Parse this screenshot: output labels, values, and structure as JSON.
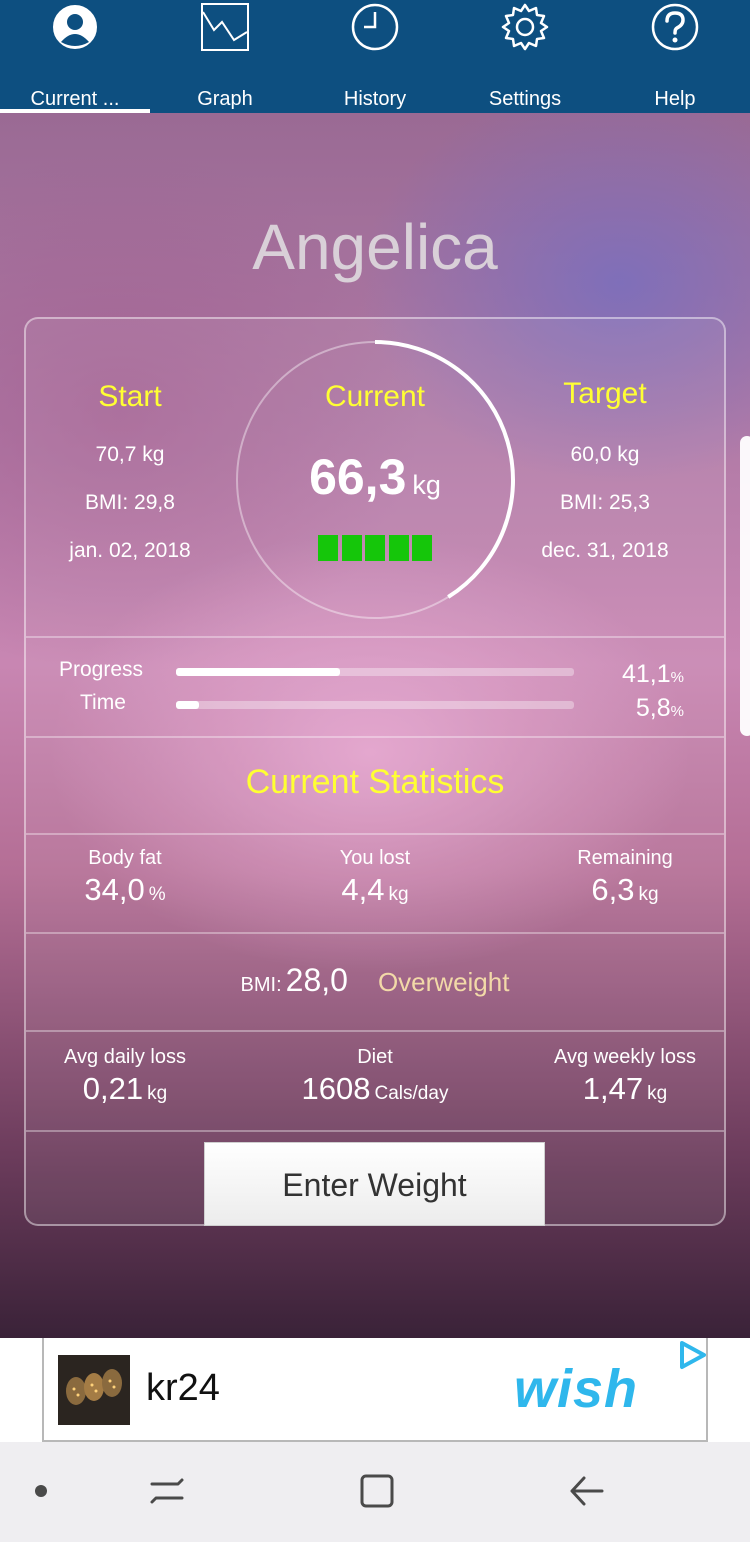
{
  "tabs": [
    {
      "label": "Current ...",
      "icon": "profile-icon",
      "active": true
    },
    {
      "label": "Graph",
      "icon": "graph-icon",
      "active": false
    },
    {
      "label": "History",
      "icon": "clock-icon",
      "active": false
    },
    {
      "label": "Settings",
      "icon": "gear-icon",
      "active": false
    },
    {
      "label": "Help",
      "icon": "help-icon",
      "active": false
    }
  ],
  "user": {
    "name": "Angelica"
  },
  "start": {
    "title": "Start",
    "weight": "70,7 kg",
    "bmi": "BMI: 29,8",
    "date": "jan. 02, 2018"
  },
  "current": {
    "title": "Current",
    "value": "66,3",
    "unit": "kg",
    "progress_blocks": 5
  },
  "target": {
    "title": "Target",
    "weight": "60,0 kg",
    "bmi": "BMI: 25,3",
    "date": "dec. 31, 2018"
  },
  "progress": {
    "progress_label": "Progress",
    "progress_value": "41,1",
    "progress_fraction": 0.411,
    "time_label": "Time",
    "time_value": "5,8",
    "time_fraction": 0.058,
    "pct_symbol": "%"
  },
  "stats": {
    "title": "Current Statistics",
    "body_fat": {
      "label": "Body fat",
      "value": "34,0",
      "unit": "%"
    },
    "you_lost": {
      "label": "You lost",
      "value": "4,4",
      "unit": "kg"
    },
    "remaining": {
      "label": "Remaining",
      "value": "6,3",
      "unit": "kg"
    },
    "bmi": {
      "label": "BMI:",
      "value": "28,0",
      "class": "Overweight"
    },
    "avg_daily": {
      "label": "Avg daily loss",
      "value": "0,21",
      "unit": "kg"
    },
    "diet": {
      "label": "Diet",
      "value": "1608",
      "unit": "Cals/day"
    },
    "avg_weekly": {
      "label": "Avg weekly loss",
      "value": "1,47",
      "unit": "kg"
    }
  },
  "enter_button": {
    "label": "Enter Weight"
  },
  "ad": {
    "text": "kr24",
    "brand": "wish"
  },
  "colors": {
    "accent_yellow": "#ffff33",
    "tabbar": "#0d4f80",
    "progress_green": "#15c60a",
    "overweight": "#f2d9a8"
  }
}
